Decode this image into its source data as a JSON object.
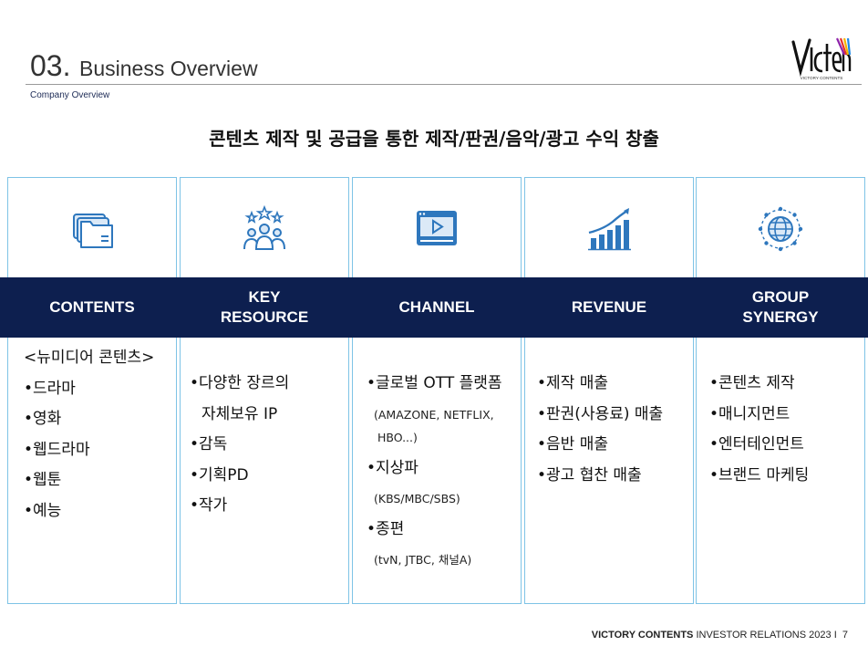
{
  "header": {
    "number": "03.",
    "title": "Business Overview",
    "subtitle": "Company Overview"
  },
  "logo": {
    "wordmark": "Victents",
    "tagline": "VICTORY CONTENTS"
  },
  "headline": "콘텐츠 제작 및 공급을 통한 제작/판권/음악/광고 수익 창출",
  "columns": [
    {
      "title": "CONTENTS",
      "icon": "folders-icon",
      "items": [
        "<뉴미디어 콘텐츠>",
        "•드라마",
        "•영화",
        "•웹드라마",
        "•웹툰",
        "•예능"
      ]
    },
    {
      "title": "KEY\nRESOURCE",
      "icon": "people-stars-icon",
      "items": [
        "•다양한 장르의",
        "자체보유 IP",
        "•감독",
        "•기획PD",
        "•작가"
      ]
    },
    {
      "title": "CHANNEL",
      "icon": "video-player-icon",
      "items": [
        "•글로벌 OTT 플랫폼",
        "(AMAZONE, NETFLIX,",
        "HBO...)",
        "•지상파",
        "(KBS/MBC/SBS)",
        "•종편",
        "(tvN, JTBC, 채널A)"
      ]
    },
    {
      "title": "REVENUE",
      "icon": "growth-chart-icon",
      "items": [
        "•제작 매출",
        "•판권(사용료) 매출",
        "•음반 매출",
        "•광고 협찬 매출"
      ]
    },
    {
      "title": "GROUP\nSYNERGY",
      "icon": "globe-network-icon",
      "items": [
        "•콘텐츠 제작",
        "•매니지먼트",
        "•엔터테인먼트",
        "•브랜드 마케팅"
      ]
    }
  ],
  "footer": {
    "brand": "VICTORY CONTENTS",
    "text": "INVESTOR RELATIONS 2023",
    "separator": "I",
    "page": "7"
  },
  "colors": {
    "navy": "#0d1f4f",
    "border": "#7ec3e6",
    "icon_blue": "#2e77bd"
  }
}
